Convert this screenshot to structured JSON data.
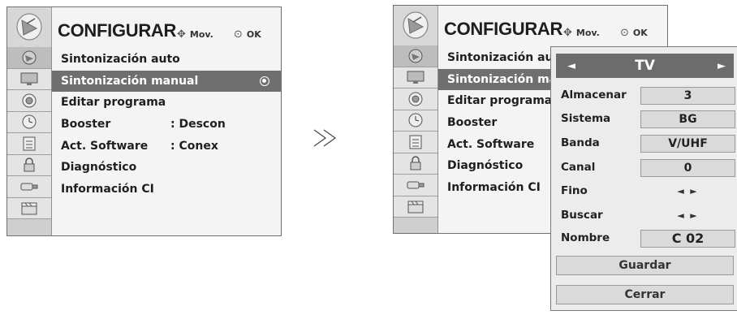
{
  "colors": {
    "panel_bg": "#f4f4f4",
    "header_icon_bg": "#d7d7d7",
    "selected_row_bg": "#6f6f6f",
    "popup_bg": "#ececec",
    "field_bg": "#dadada"
  },
  "left_panel": {
    "title": "CONFIGURAR",
    "hint_move": "Mov.",
    "hint_ok": "OK",
    "side_icons": [
      "antenna-icon",
      "tv-screen-icon",
      "audio-icon",
      "clock-icon",
      "option-icon",
      "lock-icon",
      "usb-icon",
      "movie-icon"
    ],
    "items": [
      {
        "label": "Sintonización auto",
        "value": ""
      },
      {
        "label": "Sintonización manual",
        "value": ""
      },
      {
        "label": "Editar programa",
        "value": ""
      },
      {
        "label": "Booster",
        "value": ": Descon"
      },
      {
        "label": "Act. Software",
        "value": ": Conex"
      },
      {
        "label": "Diagnóstico",
        "value": ""
      },
      {
        "label": "Información CI",
        "value": ""
      }
    ],
    "selected_index": 1
  },
  "separator": "≫",
  "right_panel": {
    "title": "CONFIGURAR",
    "hint_move": "Mov.",
    "hint_ok": "OK",
    "side_icons": [
      "antenna-icon",
      "tv-screen-icon",
      "audio-icon",
      "clock-icon",
      "option-icon",
      "lock-icon",
      "usb-icon",
      "movie-icon"
    ],
    "items": [
      {
        "label": "Sintonización auto"
      },
      {
        "label": "Sintonización manual"
      },
      {
        "label": "Editar programa"
      },
      {
        "label": "Booster"
      },
      {
        "label": "Act. Software"
      },
      {
        "label": "Diagnóstico"
      },
      {
        "label": "Información CI"
      }
    ],
    "selected_index": 1
  },
  "popup": {
    "source": "TV",
    "rows": [
      {
        "label": "Almacenar",
        "value": "3",
        "kind": "box"
      },
      {
        "label": "Sistema",
        "value": "BG",
        "kind": "box"
      },
      {
        "label": "Banda",
        "value": "V/UHF",
        "kind": "box"
      },
      {
        "label": "Canal",
        "value": "0",
        "kind": "box"
      },
      {
        "label": "Fino",
        "value": "◄ ►",
        "kind": "arrows"
      },
      {
        "label": "Buscar",
        "value": "◄ ►",
        "kind": "arrows"
      },
      {
        "label": "Nombre",
        "value": "C  02",
        "kind": "box-big"
      }
    ],
    "save_label": "Guardar",
    "close_label": "Cerrar"
  }
}
